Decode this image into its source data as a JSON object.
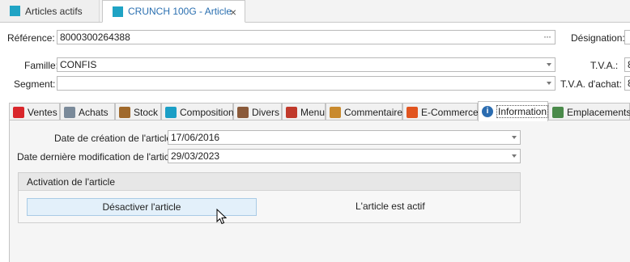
{
  "doc_tabs": [
    {
      "label": "Articles actifs"
    },
    {
      "label": "CRUNCH  100G - Article",
      "close": "×"
    }
  ],
  "form": {
    "reference": {
      "label": "Référence:",
      "value": "8000300264388",
      "ellipsis": "···"
    },
    "designation": {
      "label": "Désignation:"
    },
    "famille": {
      "label": "Famille:",
      "value": "CONFIS"
    },
    "tva": {
      "label": "T.V.A.:",
      "value": "8"
    },
    "segment": {
      "label": "Segment:",
      "value": ""
    },
    "tva_achat": {
      "label": "T.V.A. d'achat:",
      "value": "8"
    }
  },
  "tabs": [
    {
      "label": "Ventes",
      "icon": "ventes-icon",
      "color": "#d9262b"
    },
    {
      "label": "Achats",
      "icon": "truck-icon",
      "color": "#7a8a9a"
    },
    {
      "label": "Stock",
      "icon": "box-icon",
      "color": "#a0692b"
    },
    {
      "label": "Composition",
      "icon": "composition-icon",
      "color": "#1b9fc6"
    },
    {
      "label": "Divers",
      "icon": "divers-icon",
      "color": "#8a5a3a"
    },
    {
      "label": "Menu",
      "icon": "utensils-icon",
      "color": "#c0392b"
    },
    {
      "label": "Commentaire",
      "icon": "comment-icon",
      "color": "#c98a2e"
    },
    {
      "label": "E-Commerce",
      "icon": "magento-icon",
      "color": "#e1541f"
    },
    {
      "label": "Information",
      "icon": "info-icon",
      "color": "#2b6cb0",
      "active": true
    },
    {
      "label": "Emplacements",
      "icon": "locations-icon",
      "color": "#4a8a4a"
    }
  ],
  "info": {
    "creation": {
      "label": "Date de création de l'article:",
      "value": "17/06/2016"
    },
    "modification": {
      "label": "Date dernière modification de l'article:",
      "value": "29/03/2023"
    },
    "group_title": "Activation de l'article",
    "deactivate_button": "Désactiver l'article",
    "status_text": "L'article est actif"
  }
}
